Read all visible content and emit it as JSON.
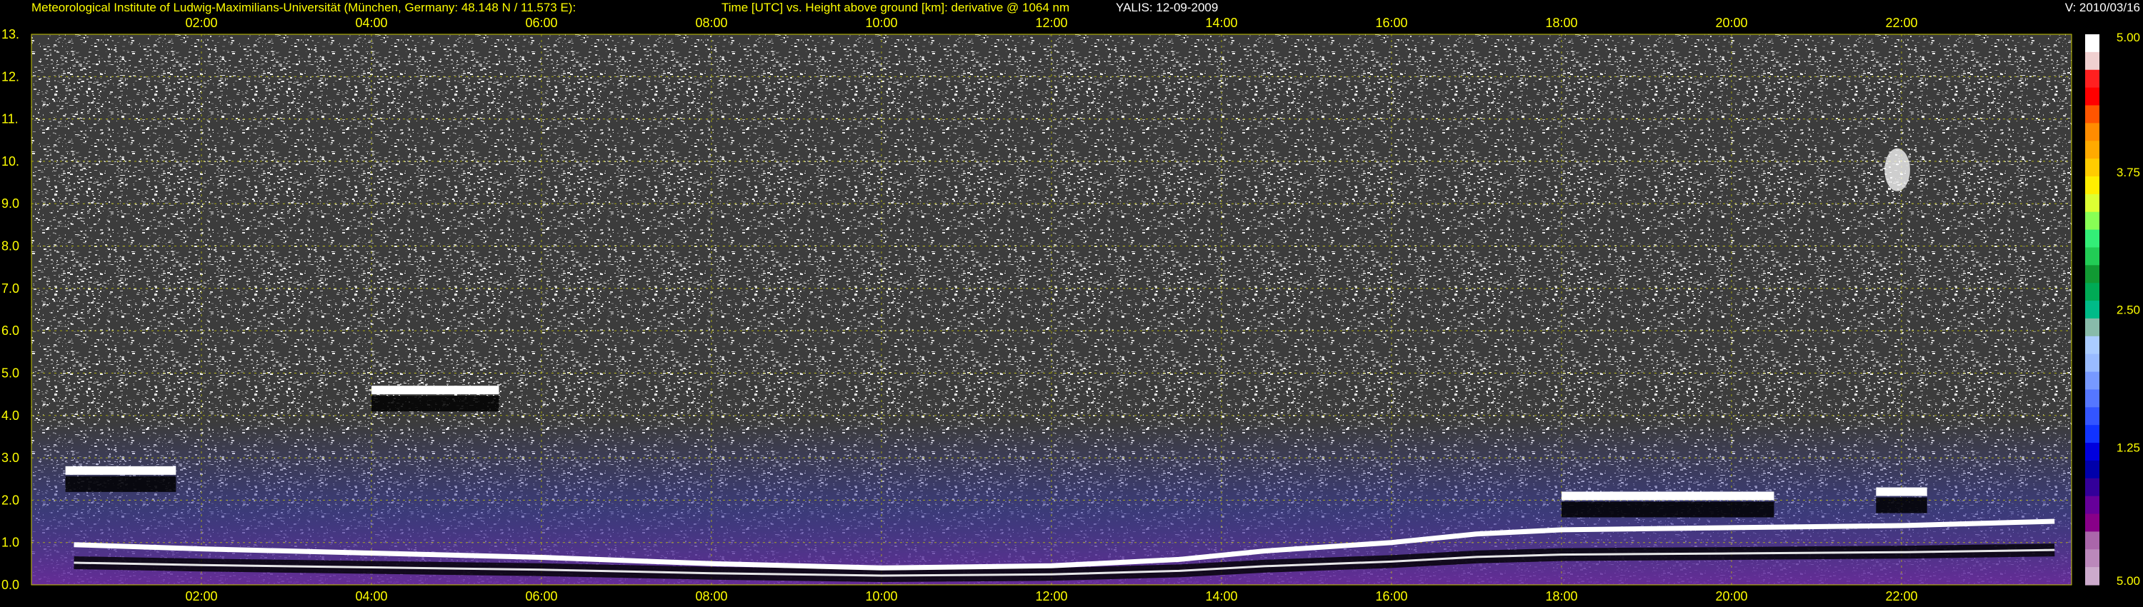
{
  "header": {
    "institute": "Meteorological Institute of Ludwig-Maximilians-Universität (München, Germany: 48.148 N / 11.573 E):",
    "plot_description": "Time [UTC] vs. Height above ground [km]: derivative @ 1064 nm",
    "instrument_date": "YALIS: 12-09-2009",
    "version": "V: 2010/03/16"
  },
  "chart_data": {
    "type": "heatmap",
    "xlabel": "Time [UTC]",
    "ylabel": "Height above ground [km]",
    "x_range_hours": [
      0.0,
      24.0
    ],
    "x_ticks": [
      "02:00",
      "04:00",
      "06:00",
      "08:00",
      "10:00",
      "12:00",
      "14:00",
      "16:00",
      "18:00",
      "20:00",
      "22:00"
    ],
    "y_range_km": [
      0.0,
      13.0
    ],
    "y_ticks": [
      "0.0",
      "1.0",
      "2.0",
      "3.0",
      "4.0",
      "5.0",
      "6.0",
      "7.0",
      "8.0",
      "9.0",
      "10.",
      "11.",
      "12.",
      "13."
    ],
    "grid": true,
    "colorbar": {
      "range": [
        5.0,
        5.0
      ],
      "tick_labels": [
        "5.00",
        "3.75",
        "2.50",
        "1.25",
        "5.00"
      ],
      "colors_top_to_bottom": [
        "#ffffff",
        "#f0d0d0",
        "#ff2020",
        "#ff0000",
        "#ff5500",
        "#ff8c00",
        "#ffaa00",
        "#ffcc00",
        "#ffee00",
        "#ddff33",
        "#88ff55",
        "#33ee77",
        "#22cc55",
        "#119933",
        "#00aa55",
        "#00bb88",
        "#88bbaa",
        "#aaccff",
        "#99bbff",
        "#7799ff",
        "#5577ff",
        "#3355ff",
        "#1133ff",
        "#0000dd",
        "#0000aa",
        "#330099",
        "#660099",
        "#880088",
        "#aa66aa",
        "#bb88bb",
        "#ccaacc"
      ]
    },
    "features": [
      {
        "name": "boundary layer top",
        "x_hours": [
          0.5,
          2,
          4,
          6,
          8,
          10,
          12,
          13.5,
          14.5,
          16,
          17,
          18,
          20,
          22,
          23.8
        ],
        "height_km": [
          0.95,
          0.85,
          0.75,
          0.65,
          0.5,
          0.4,
          0.45,
          0.6,
          0.8,
          1.0,
          1.2,
          1.3,
          1.35,
          1.4,
          1.5
        ]
      },
      {
        "name": "cloud layer",
        "x_start_hours": 0.4,
        "x_end_hours": 1.7,
        "height_km": 2.7
      },
      {
        "name": "cloud layer",
        "x_start_hours": 4.0,
        "x_end_hours": 5.5,
        "height_km": 4.6
      },
      {
        "name": "cloud layer",
        "x_start_hours": 18.0,
        "x_end_hours": 20.5,
        "height_km": 2.1
      },
      {
        "name": "cloud layer",
        "x_start_hours": 21.7,
        "x_end_hours": 22.3,
        "height_km": 2.2
      },
      {
        "name": "cloud patch",
        "x_start_hours": 21.8,
        "x_end_hours": 22.1,
        "height_km": 9.8
      }
    ],
    "colors": {
      "text": "#ffff00",
      "grid": "#c8c800",
      "background": "#000000",
      "noise": "#b4b4b4",
      "aerosol_low": "#6a2aa0",
      "aerosol_mid": "#3a3aa0"
    }
  }
}
